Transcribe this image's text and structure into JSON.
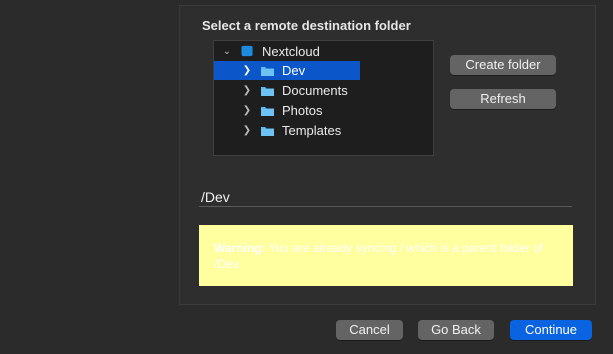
{
  "dialog": {
    "title": "Select a remote destination folder"
  },
  "tree": {
    "root": {
      "label": "Nextcloud",
      "expanded": true,
      "icon": "nextcloud-folder-icon"
    },
    "children": [
      {
        "label": "Dev",
        "selected": true,
        "icon": "folder-icon"
      },
      {
        "label": "Documents",
        "selected": false,
        "icon": "folder-icon"
      },
      {
        "label": "Photos",
        "selected": false,
        "icon": "folder-icon"
      },
      {
        "label": "Templates",
        "selected": false,
        "icon": "folder-icon"
      }
    ]
  },
  "actions": {
    "create_folder": "Create folder",
    "refresh": "Refresh"
  },
  "path": {
    "value": "/Dev"
  },
  "warning": {
    "prefix": "Warning:",
    "message": " You are already syncing / which is a parent folder of /Dev."
  },
  "footer": {
    "cancel": "Cancel",
    "go_back": "Go Back",
    "continue": "Continue"
  },
  "colors": {
    "selection": "#0b57c9",
    "primary_button": "#0a64e1",
    "warning_background": "#ffff9f",
    "folder": "#5eb8f0",
    "root_folder": "#1e8be0"
  }
}
